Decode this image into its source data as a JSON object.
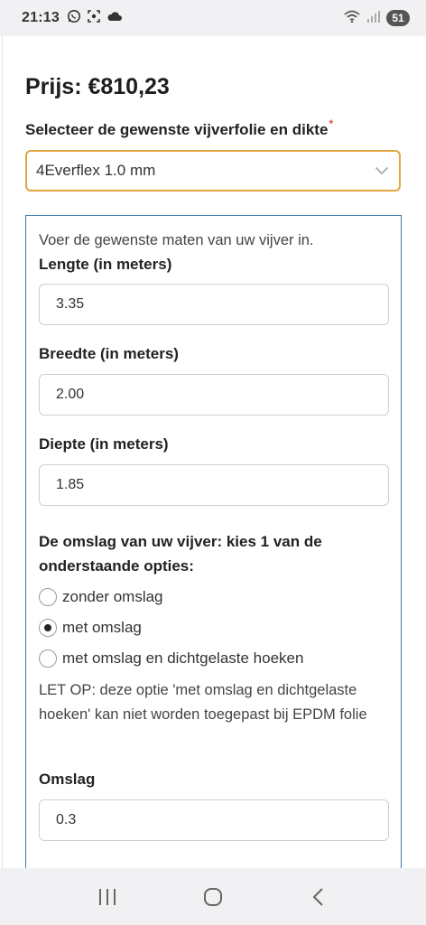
{
  "status_bar": {
    "time": "21:13",
    "battery": "51",
    "left_icons": [
      "whatsapp-icon",
      "screenshot-icon",
      "cloud-icon"
    ],
    "right_icons": [
      "wifi-icon",
      "signal-icon"
    ]
  },
  "product": {
    "price": "Prijs: €810,23",
    "select_label": "Selecteer de gewenste vijverfolie en dikte",
    "required_mark": "*",
    "selected_option": "4Everflex 1.0 mm"
  },
  "form": {
    "intro": "Voer de gewenste maten van uw vijver in.",
    "fields": [
      {
        "label": "Lengte (in meters)",
        "value": "3.35"
      },
      {
        "label": "Breedte (in meters)",
        "value": "2.00"
      },
      {
        "label": "Diepte (in meters)",
        "value": "1.85"
      }
    ],
    "omslag_question": "De omslag van uw vijver: kies 1 van de onderstaande opties:",
    "options": [
      {
        "label": "zonder omslag",
        "selected": false
      },
      {
        "label": "met omslag",
        "selected": true
      },
      {
        "label": "met omslag en dichtgelaste hoeken",
        "selected": false
      }
    ],
    "note": "LET OP: deze optie 'met omslag en dichtgelaste hoeken' kan niet worden toegepast bij EPDM folie",
    "omslag_label": "Omslag",
    "omslag_value": "0.3"
  },
  "colors": {
    "accent_select_border": "#e0a642",
    "panel_border": "#3b79b8"
  },
  "nav_bar": {
    "icons": [
      "recent-apps-icon",
      "home-icon",
      "back-icon"
    ]
  }
}
